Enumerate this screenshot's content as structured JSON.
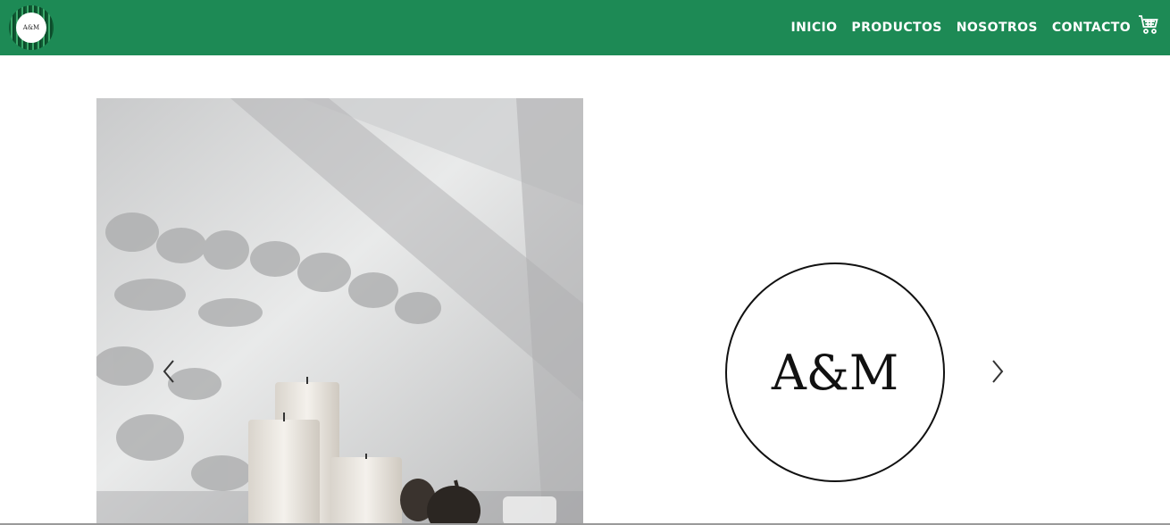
{
  "header": {
    "logo_text": "A&M",
    "nav": [
      {
        "label": "INICIO"
      },
      {
        "label": "PRODUCTOS"
      },
      {
        "label": "NOSOTROS"
      },
      {
        "label": "CONTACTO"
      }
    ],
    "cart_icon": "cart-icon"
  },
  "carousel": {
    "brand_text": "A&M",
    "prev_icon": "chevron-left-icon",
    "next_icon": "chevron-right-icon"
  },
  "colors": {
    "nav_background": "#1d8a55",
    "nav_text": "#ffffff",
    "page_background": "#ffffff"
  }
}
